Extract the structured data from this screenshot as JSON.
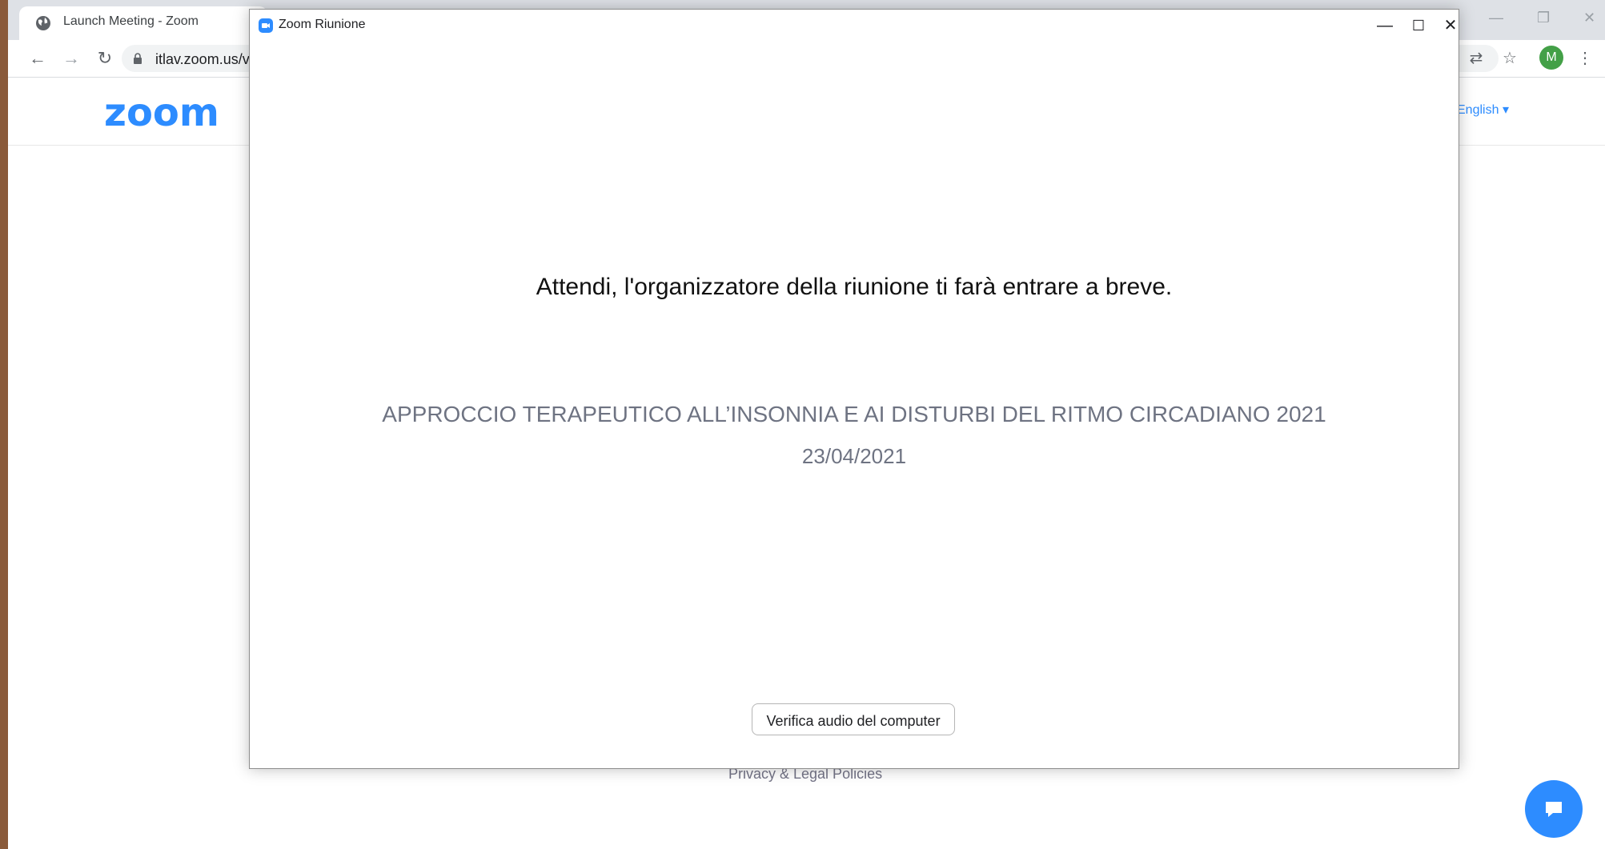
{
  "browser": {
    "tab_title": "Launch Meeting - Zoom",
    "url": "itlav.zoom.us/v",
    "avatar_initial": "M"
  },
  "site": {
    "logo_text": "zoom",
    "language": "English",
    "footer_link": "Privacy & Legal Policies",
    "brand_color": "#2d8cff"
  },
  "zoom_window": {
    "title": "Zoom Riunione",
    "waiting_message": "Attendi, l'organizzatore della riunione ti farà entrare a breve.",
    "meeting_topic": "APPROCCIO TERAPEUTICO ALL’INSONNIA E AI DISTURBI DEL RITMO CIRCADIANO 2021",
    "meeting_date": "23/04/2021",
    "audio_test_button": "Verifica audio del computer"
  },
  "icons": [
    "globe-icon",
    "close-icon",
    "back-icon",
    "forward-icon",
    "reload-icon",
    "lock-icon",
    "translate-icon",
    "star-icon",
    "kebab-menu-icon",
    "minimize-icon",
    "maximize-icon",
    "chat-icon"
  ]
}
